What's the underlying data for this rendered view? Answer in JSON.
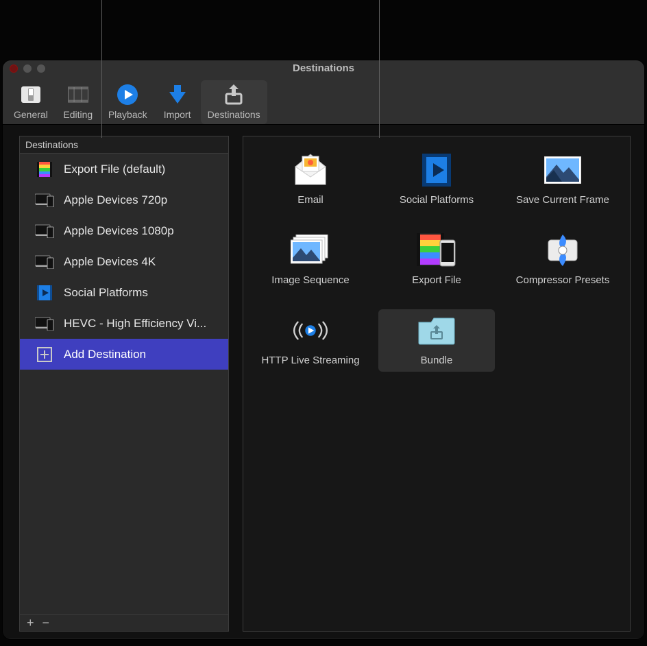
{
  "window": {
    "title": "Destinations"
  },
  "toolbar": {
    "items": [
      {
        "id": "general",
        "label": "General"
      },
      {
        "id": "editing",
        "label": "Editing"
      },
      {
        "id": "playback",
        "label": "Playback"
      },
      {
        "id": "import",
        "label": "Import"
      },
      {
        "id": "destinations",
        "label": "Destinations"
      }
    ],
    "active": "destinations"
  },
  "sidebar": {
    "header": "Destinations",
    "items": [
      {
        "id": "export-file",
        "label": "Export File (default)"
      },
      {
        "id": "apple-720",
        "label": "Apple Devices 720p"
      },
      {
        "id": "apple-1080",
        "label": "Apple Devices 1080p"
      },
      {
        "id": "apple-4k",
        "label": "Apple Devices 4K"
      },
      {
        "id": "social",
        "label": "Social Platforms"
      },
      {
        "id": "hevc",
        "label": "HEVC - High Efficiency Vi..."
      },
      {
        "id": "add",
        "label": "Add Destination"
      }
    ],
    "selected": "add"
  },
  "gallery": {
    "items": [
      {
        "id": "email",
        "label": "Email"
      },
      {
        "id": "social",
        "label": "Social Platforms"
      },
      {
        "id": "save-frame",
        "label": "Save Current Frame"
      },
      {
        "id": "image-seq",
        "label": "Image Sequence"
      },
      {
        "id": "export-file",
        "label": "Export File"
      },
      {
        "id": "compressor",
        "label": "Compressor Presets"
      },
      {
        "id": "hls",
        "label": "HTTP Live Streaming"
      },
      {
        "id": "bundle",
        "label": "Bundle"
      }
    ],
    "selected": "bundle"
  },
  "footer": {
    "add": "+",
    "remove": "−"
  },
  "colors": {
    "accent": "#1d7fe6",
    "selected_row": "#3f3fbf"
  }
}
